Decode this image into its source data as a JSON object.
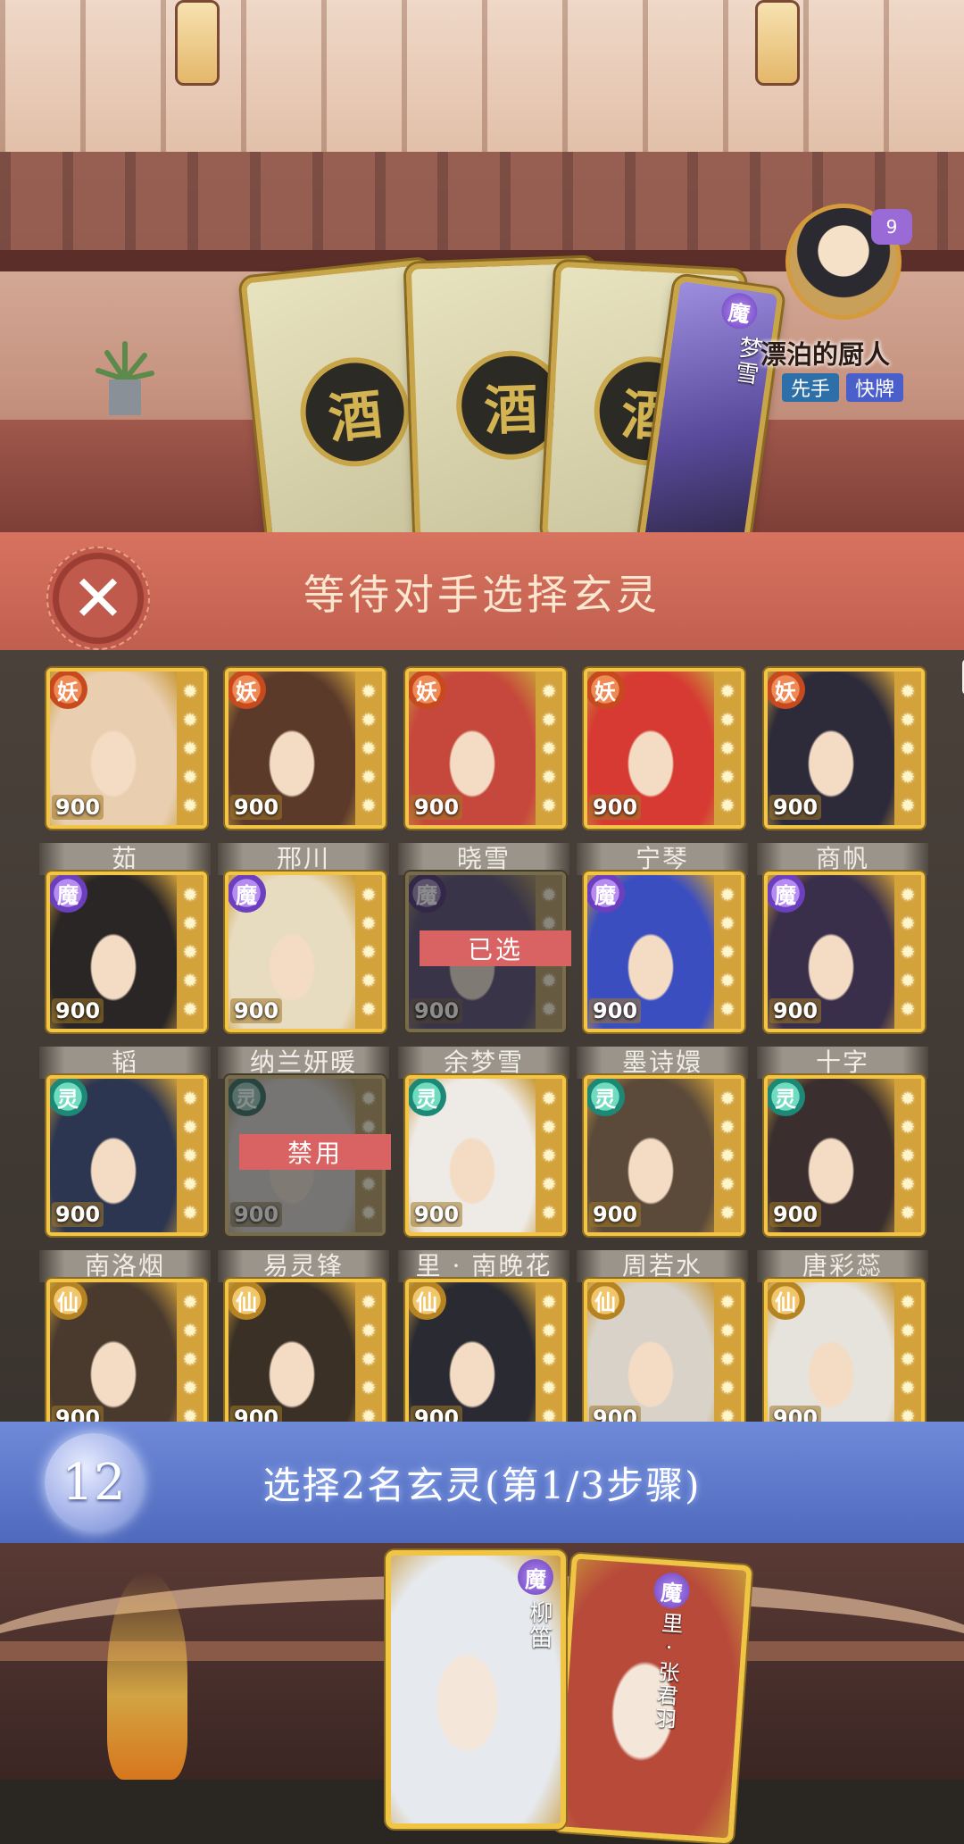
{
  "opponent": {
    "name": "漂泊的厨人",
    "level": "9",
    "tags": [
      "先手",
      "快牌"
    ],
    "face_down_glyph": "酒",
    "revealed_card": {
      "faction": "魔",
      "name": "梦雪"
    }
  },
  "wait_banner": {
    "text": "等待对手选择玄灵",
    "close_glyph": "✕"
  },
  "grid": {
    "cells": [
      {
        "faction": "妖",
        "cost": "900",
        "name": "茹",
        "color": "#e9cfb0"
      },
      {
        "faction": "妖",
        "cost": "900",
        "name": "邢川",
        "color": "#5b3a2a"
      },
      {
        "faction": "妖",
        "cost": "900",
        "name": "晓雪",
        "color": "#c6473b"
      },
      {
        "faction": "妖",
        "cost": "900",
        "name": "宁琴",
        "color": "#d63a33"
      },
      {
        "faction": "妖",
        "cost": "900",
        "name": "商帆",
        "color": "#2d2a3a"
      },
      {
        "faction": "魔",
        "cost": "900",
        "name": "韬",
        "color": "#2a2626"
      },
      {
        "faction": "魔",
        "cost": "900",
        "name": "纳兰妍暖",
        "color": "#e8dcc0"
      },
      {
        "faction": "魔",
        "cost": "900",
        "name": "余梦雪",
        "color": "#6b5aa8",
        "overlay": "已选"
      },
      {
        "faction": "魔",
        "cost": "900",
        "name": "墨诗嬛",
        "color": "#3b4ec0"
      },
      {
        "faction": "魔",
        "cost": "900",
        "name": "十字",
        "color": "#3a2f4a"
      },
      {
        "faction": "灵",
        "cost": "900",
        "name": "南洛烟",
        "color": "#2d3650"
      },
      {
        "faction": "灵",
        "cost": "900",
        "name": "易灵锋",
        "color": "#d8d4cc",
        "overlay": "禁用"
      },
      {
        "faction": "灵",
        "cost": "900",
        "name": "里 · 南晚花",
        "color": "#eeeae6"
      },
      {
        "faction": "灵",
        "cost": "900",
        "name": "周若水",
        "color": "#5b4a3a"
      },
      {
        "faction": "灵",
        "cost": "900",
        "name": "唐彩蕊",
        "color": "#3a2e2e"
      },
      {
        "faction": "仙",
        "cost": "900",
        "name": "",
        "color": "#4a3a2e"
      },
      {
        "faction": "仙",
        "cost": "900",
        "name": "",
        "color": "#3a3026"
      },
      {
        "faction": "仙",
        "cost": "900",
        "name": "",
        "color": "#2a2a32"
      },
      {
        "faction": "仙",
        "cost": "900",
        "name": "",
        "color": "#d8d2c8"
      },
      {
        "faction": "仙",
        "cost": "900",
        "name": "",
        "color": "#e6e2dc"
      }
    ]
  },
  "step": {
    "timer": "12",
    "text": "选择2名玄灵(第1/3步骤)"
  },
  "my_cards": [
    {
      "faction": "魔",
      "name": "柳笛",
      "color": "#e6e9ee"
    },
    {
      "faction": "魔",
      "name": "里 · 张君羽",
      "color": "#b84a3a"
    }
  ]
}
